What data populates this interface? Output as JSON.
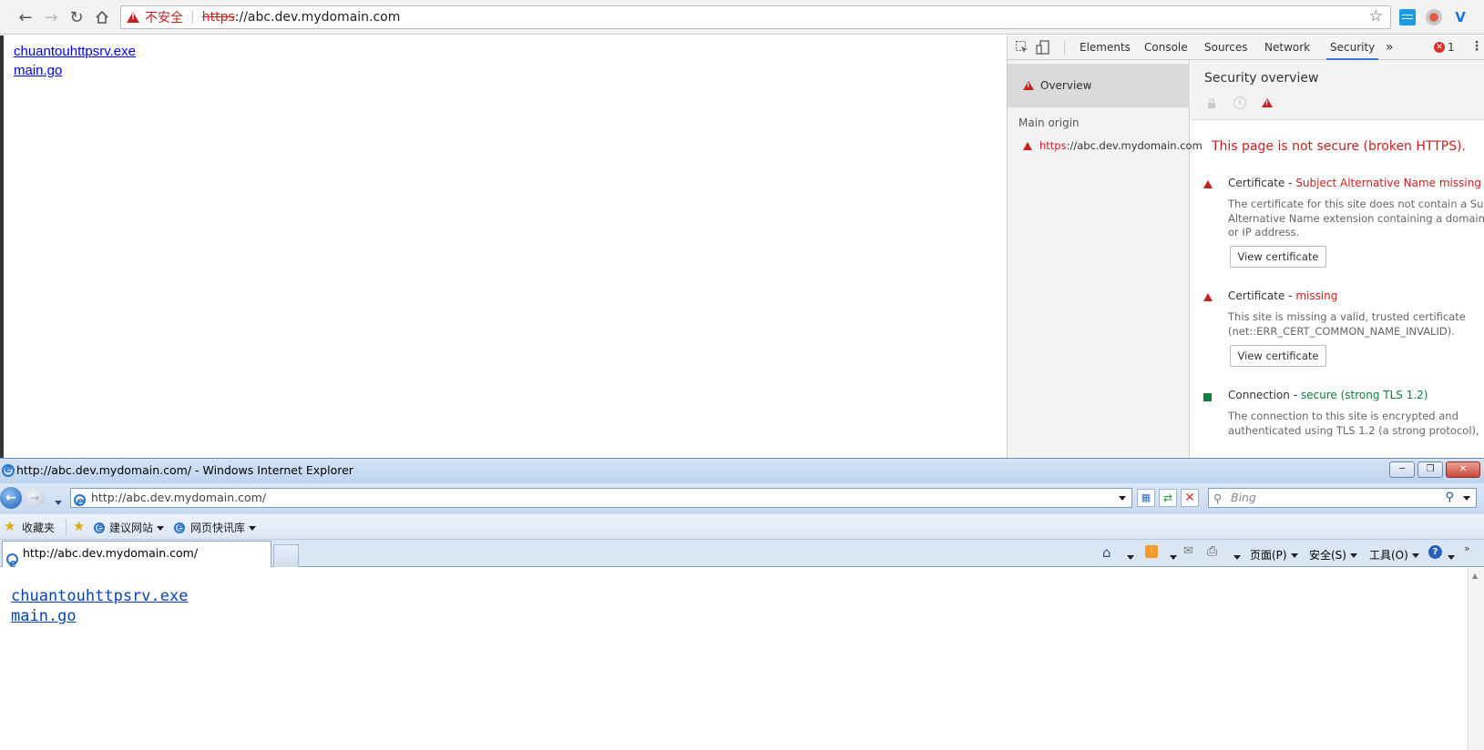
{
  "chrome": {
    "omnibox": {
      "not_secure": "不安全",
      "scheme": "https",
      "rest": "://abc.dev.mydomain.com"
    },
    "page_links": [
      "chuantouhttpsrv.exe",
      "main.go"
    ],
    "devtools": {
      "tabs": [
        "Elements",
        "Console",
        "Sources",
        "Network",
        "Security"
      ],
      "active_tab": "Security",
      "more_tabs": "»",
      "error_count": "1",
      "sidebar": {
        "overview": "Overview",
        "main_origin_label": "Main origin",
        "origin_scheme": "https",
        "origin_rest": "://abc.dev.mydomain.com"
      },
      "security_overview": {
        "title": "Security overview",
        "summary": "This page is not secure (broken HTTPS).",
        "explanations": [
          {
            "title": "Certificate",
            "status": "Subject Alternative Name missing",
            "status_color": "#c5221f",
            "desc_lines": [
              "The certificate for this site does not contain a Subject",
              "Alternative Name extension containing a domain nam",
              "or IP address."
            ],
            "button": "View certificate"
          },
          {
            "title": "Certificate",
            "status": "missing",
            "status_color": "#c5221f",
            "desc_lines": [
              "This site is missing a valid, trusted certificate",
              "(net::ERR_CERT_COMMON_NAME_INVALID)."
            ],
            "button": "View certificate"
          },
          {
            "title": "Connection",
            "status": "secure (strong TLS 1.2)",
            "status_color": "#0b8043",
            "desc_lines": [
              "The connection to this site is encrypted and",
              "authenticated using TLS 1.2 (a strong protocol),"
            ]
          }
        ]
      }
    }
  },
  "ie": {
    "window_title": "http://abc.dev.mydomain.com/ - Windows Internet Explorer",
    "address": "http://abc.dev.mydomain.com/",
    "search_placeholder": "Bing",
    "favorites": {
      "favorites_label": "收藏夹",
      "suggested_sites": "建议网站",
      "web_slice_gallery": "网页快讯库"
    },
    "tab_title": "http://abc.dev.mydomain.com/",
    "commands": {
      "page": "页面(P)",
      "safety": "安全(S)",
      "tools": "工具(O)"
    },
    "page_links": [
      "chuantouhttpsrv.exe",
      "main.go"
    ]
  }
}
